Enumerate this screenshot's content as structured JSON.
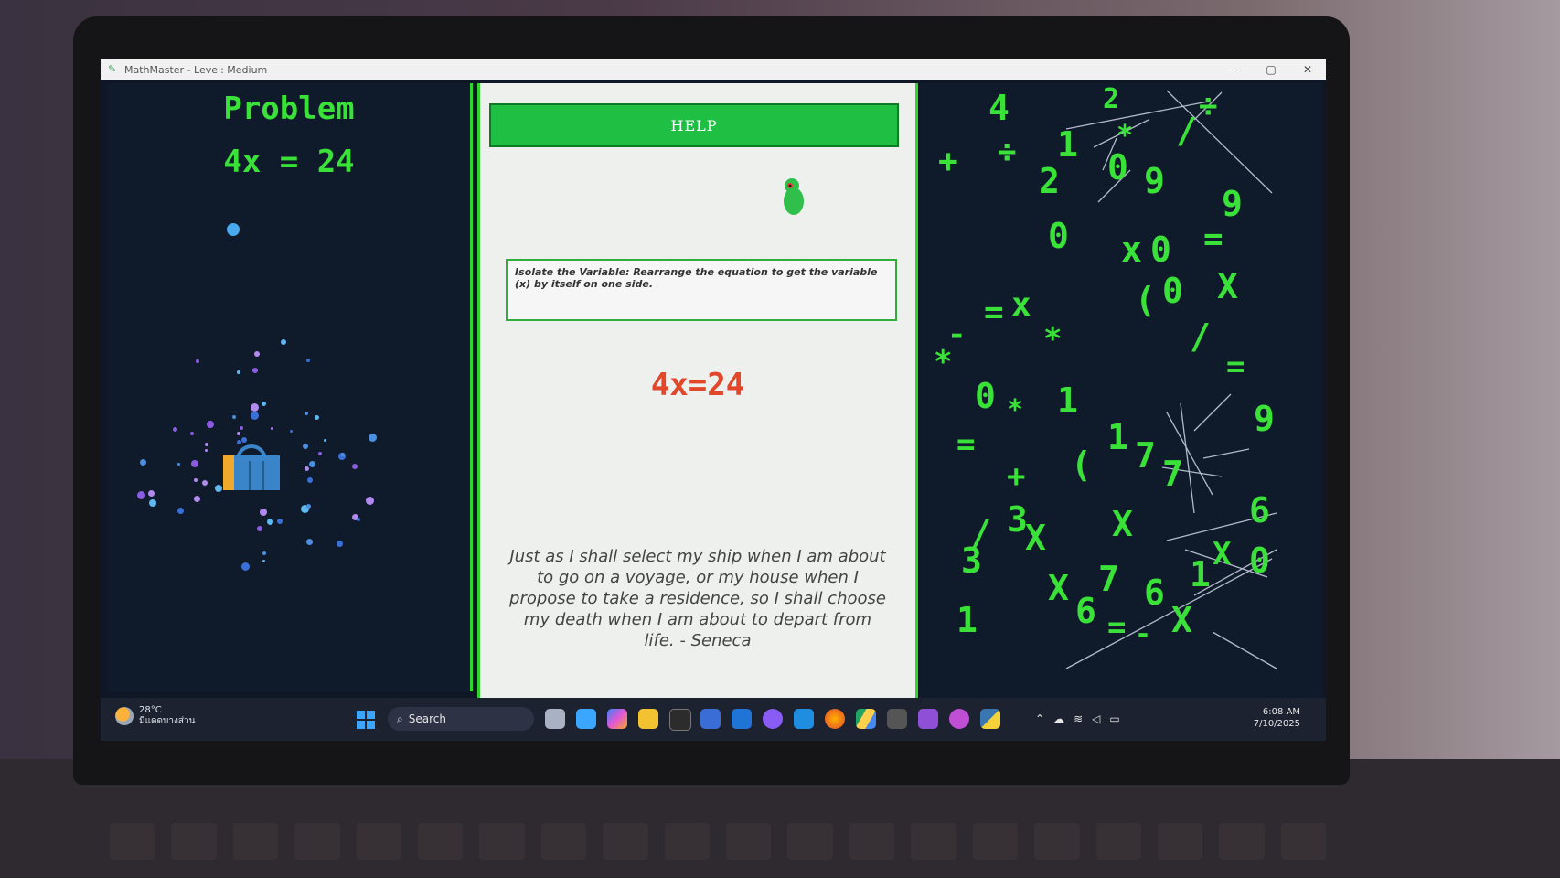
{
  "window": {
    "title": "MathMaster - Level: Medium",
    "controls": [
      "–",
      "▢",
      "✕"
    ]
  },
  "left_panel": {
    "heading": "Problem",
    "equation": "4x = 24"
  },
  "middle_panel": {
    "help_label": "HELP",
    "hint": "Isolate the Variable: Rearrange the equation to get the variable (x) by itself on one side.",
    "equation": "4x=24",
    "quote": "Just as I shall select my ship when I am about to go on a voyage, or my house when I propose to take a residence, so I shall choose my death when I am about to depart from life. - Seneca"
  },
  "right_panel": {
    "falling_symbols": [
      "4",
      "2",
      "÷",
      "+",
      "÷",
      "1",
      "2",
      "0",
      "9",
      "*",
      "/",
      "9",
      "0",
      "x",
      "0",
      "=",
      "=",
      "x",
      "(",
      "0",
      "X",
      "-",
      "*",
      "*",
      "/",
      "=",
      "0",
      "*",
      "1",
      "9",
      "=",
      "1",
      "7",
      "7",
      "+",
      "(",
      "3",
      "X",
      "6",
      "/",
      "X",
      "3",
      "X",
      "X",
      "7",
      "1",
      "0",
      "6",
      "6",
      "1",
      "X",
      "=",
      "-"
    ]
  },
  "taskbar": {
    "weather_temp": "28°C",
    "weather_desc": "มีแดดบางส่วน",
    "search_label": "Search",
    "time": "6:08 AM",
    "date": "7/10/2025",
    "icons": [
      "windows-start-icon",
      "search-icon",
      "file-explorer-icon",
      "notepad-icon",
      "copilot-icon",
      "folder-icon",
      "terminal-icon",
      "remote-desktop-icon",
      "outlook-icon",
      "github-icon",
      "vscode-icon",
      "firefox-icon",
      "google-drive-icon",
      "app-icon",
      "visual-studio-icon",
      "app-icon-2",
      "python-icon"
    ]
  }
}
